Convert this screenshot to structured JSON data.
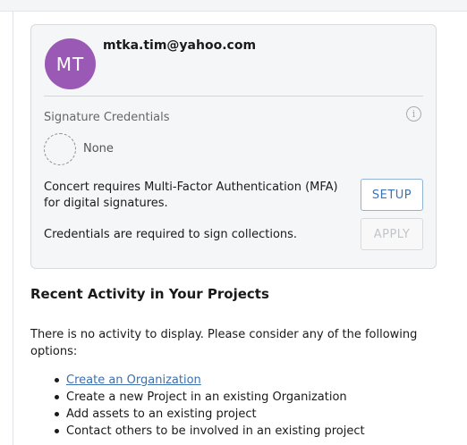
{
  "profile": {
    "initials": "MT",
    "email": "mtka.tim@yahoo.com",
    "avatar_color": "#9b59b6"
  },
  "signature": {
    "label": "Signature Credentials",
    "info_icon": "info-circle-icon",
    "credential_status": "None",
    "mfa_message": "Concert requires Multi-Factor Authentication (MFA) for digital signatures.",
    "setup_label": "SETUP",
    "credentials_message": "Credentials are required to sign collections.",
    "apply_label": "APPLY"
  },
  "activity": {
    "title": "Recent Activity in Your Projects",
    "empty_message": "There is no activity to display. Please consider any of the following options:",
    "options": [
      {
        "label": "Create an Organization",
        "link": true
      },
      {
        "label": "Create a new Project in an existing Organization",
        "link": false
      },
      {
        "label": "Add assets to an existing project",
        "link": false
      },
      {
        "label": "Contact others to be involved in an existing project",
        "link": false
      }
    ]
  },
  "colors": {
    "link": "#3a6fb0",
    "setup_button": "#3a74b3",
    "card_background": "#f5f6f8"
  }
}
